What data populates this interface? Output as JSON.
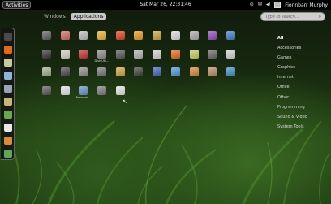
{
  "top_panel": {
    "activities_label": "Activities",
    "clock": "Sat Mar 26, 22:31:46",
    "user_name": "Fionnbarr Murphy"
  },
  "view_tabs": [
    {
      "label": "Windows",
      "active": false
    },
    {
      "label": "Applications",
      "active": true
    }
  ],
  "search": {
    "placeholder": "Type to search..."
  },
  "dash_items": [
    {
      "icon": "terminal-icon",
      "color": "#4a4a4a"
    },
    {
      "icon": "firefox-icon",
      "color": "#e06a1c"
    },
    {
      "icon": "mail-icon",
      "color": "#c9c9a0"
    },
    {
      "icon": "chat-icon",
      "color": "#8fb3d9"
    },
    {
      "icon": "network-icon",
      "color": "#9aa5b3"
    },
    {
      "icon": "files-icon",
      "color": "#c8b57a"
    },
    {
      "icon": "spreadsheet-icon",
      "color": "#6aa84f"
    },
    {
      "icon": "document-icon",
      "color": "#e8e8e8"
    },
    {
      "icon": "presentation-icon",
      "color": "#d98a3a"
    },
    {
      "icon": "monitor-icon",
      "color": "#5fa55a"
    }
  ],
  "apps": [
    {
      "label": "",
      "icon": "calculator-icon",
      "color": "#5a5a5a"
    },
    {
      "label": "",
      "icon": "settings-icon",
      "color": "#c66"
    },
    {
      "label": "",
      "icon": "package-icon",
      "color": "#b9b9b9"
    },
    {
      "label": "",
      "icon": "disc-icon",
      "color": "#e0b030"
    },
    {
      "label": "",
      "icon": "update-icon",
      "color": "#d84020"
    },
    {
      "label": "",
      "icon": "coins-icon",
      "color": "#e09a20"
    },
    {
      "label": "",
      "icon": "box-icon",
      "color": "#c8a040"
    },
    {
      "label": "",
      "icon": "text-editor-icon",
      "color": "#d8d8d8"
    },
    {
      "label": "",
      "icon": "display-icon",
      "color": "#a8a8a8"
    },
    {
      "label": "",
      "icon": "camera-icon",
      "color": "#8a4ab0"
    },
    {
      "label": "",
      "icon": "workspace-icon",
      "color": "#3a7ac0"
    },
    {
      "label": "",
      "icon": "shell-icon",
      "color": "#333"
    },
    {
      "label": "",
      "icon": "folder-icon",
      "color": "#d0d0c0"
    },
    {
      "label": "",
      "icon": "deja-dup-icon",
      "color": "#c23030"
    },
    {
      "label": "Disk Util...",
      "icon": "disk-icon",
      "color": "#888"
    },
    {
      "label": "",
      "icon": "network-icon",
      "color": "#555"
    },
    {
      "label": "",
      "icon": "document-icon",
      "color": "#b0b0b0"
    },
    {
      "label": "",
      "icon": "server-icon",
      "color": "#d0d0d0"
    },
    {
      "label": "",
      "icon": "firefox-icon",
      "color": "#e06a1c"
    },
    {
      "label": "",
      "icon": "map-icon",
      "color": "#c8c860"
    },
    {
      "label": "",
      "icon": "chess-icon",
      "color": "#666"
    },
    {
      "label": "",
      "icon": "picture-icon",
      "color": "#cfcfcf"
    },
    {
      "label": "",
      "icon": "apps-icon",
      "color": "#99aa88"
    },
    {
      "label": "",
      "icon": "mines-icon",
      "color": "#444"
    },
    {
      "label": "",
      "icon": "gear-icon",
      "color": "#888"
    },
    {
      "label": "",
      "icon": "settings-icon",
      "color": "#707070"
    },
    {
      "label": "",
      "icon": "keys-icon",
      "color": "#c8a040"
    },
    {
      "label": "",
      "icon": "calendar-icon",
      "color": "#3a3a3a"
    },
    {
      "label": "",
      "icon": "blocks-icon",
      "color": "#3a60b0"
    },
    {
      "label": "",
      "icon": "chart-icon",
      "color": "#4a90d0"
    },
    {
      "label": "",
      "icon": "paint-icon",
      "color": "#d08030"
    },
    {
      "label": "",
      "icon": "chess-icon",
      "color": "#b08860"
    },
    {
      "label": "",
      "icon": "puzzle-icon",
      "color": "#3a8ac0"
    },
    {
      "label": "",
      "icon": "graph-icon",
      "color": "#555"
    },
    {
      "label": "",
      "icon": "mahjongg-icon",
      "color": "#e0e0e0"
    },
    {
      "label": "Network...",
      "icon": "network-icon",
      "color": "#6090c0"
    },
    {
      "label": "",
      "icon": "monitor-icon",
      "color": "#777"
    },
    {
      "label": "",
      "icon": "document-icon",
      "color": "#e0e0e0"
    }
  ],
  "categories": [
    {
      "label": "All",
      "active": true
    },
    {
      "label": "Accessories",
      "active": false
    },
    {
      "label": "Games",
      "active": false
    },
    {
      "label": "Graphics",
      "active": false
    },
    {
      "label": "Internet",
      "active": false
    },
    {
      "label": "Office",
      "active": false
    },
    {
      "label": "Other",
      "active": false
    },
    {
      "label": "Programming",
      "active": false
    },
    {
      "label": "Sound & Video",
      "active": false
    },
    {
      "label": "System Tools",
      "active": false
    }
  ]
}
